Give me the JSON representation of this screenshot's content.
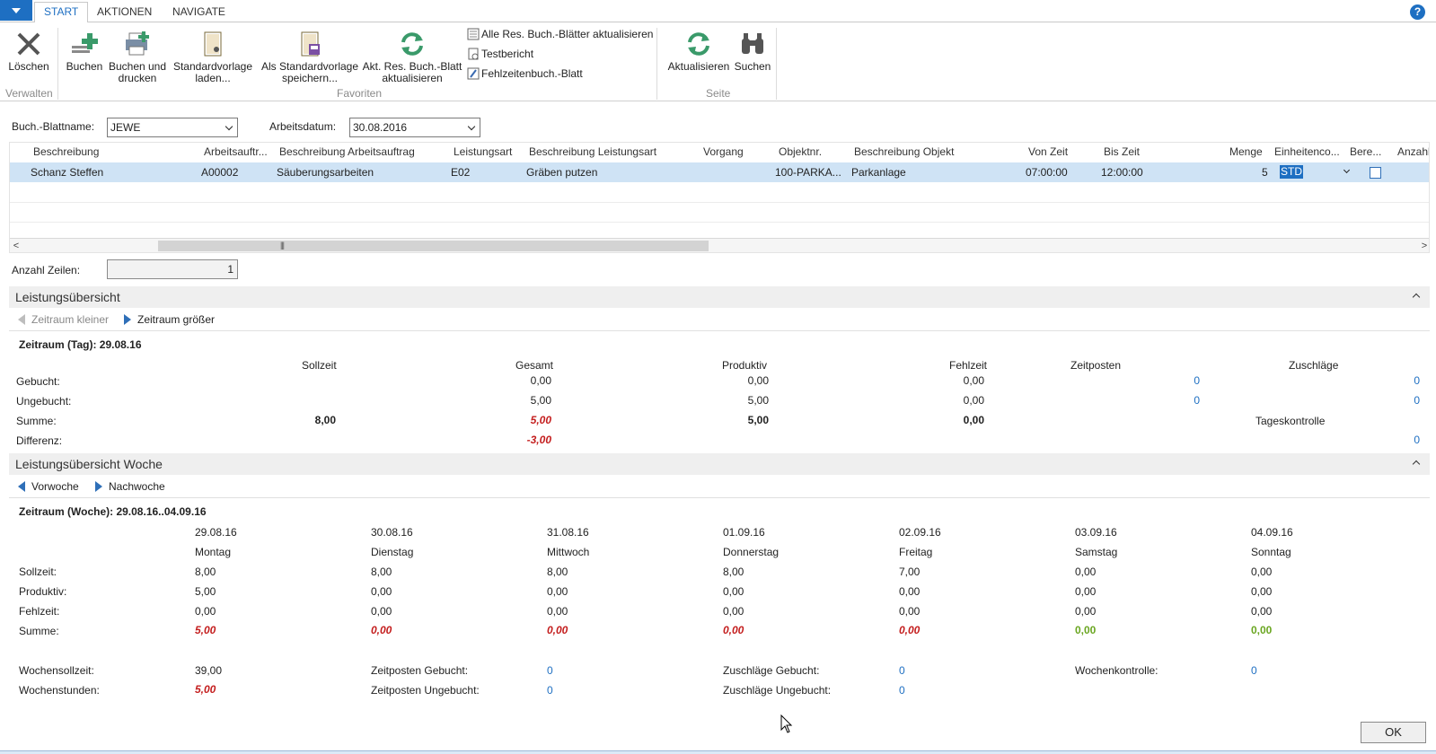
{
  "ribbon": {
    "tabs": [
      "START",
      "AKTIONEN",
      "NAVIGATE"
    ],
    "help": "?",
    "groups": {
      "verwalten": "Verwalten",
      "favoriten": "Favoriten",
      "seite": "Seite"
    },
    "buttons": {
      "loeschen": "Löschen",
      "buchen": "Buchen",
      "buchen_drucken_1": "Buchen und",
      "buchen_drucken_2": "drucken",
      "vorlage_laden_1": "Standardvorlage",
      "vorlage_laden_2": "laden...",
      "vorlage_speichern_1": "Als Standardvorlage",
      "vorlage_speichern_2": "speichern...",
      "akt_blatt_1": "Akt. Res. Buch.-Blatt",
      "akt_blatt_2": "aktualisieren",
      "alle_blaetter": "Alle Res. Buch.-Blätter aktualisieren",
      "testbericht": "Testbericht",
      "fehlzeiten": "Fehlzeitenbuch.-Blatt",
      "aktualisieren": "Aktualisieren",
      "suchen": "Suchen"
    }
  },
  "header": {
    "blattname_label": "Buch.-Blattname:",
    "blattname_value": "JEWE",
    "arbeitsdatum_label": "Arbeitsdatum:",
    "arbeitsdatum_value": "30.08.2016"
  },
  "grid": {
    "columns": [
      "Beschreibung",
      "Arbeitsauftr...",
      "Beschreibung Arbeitsauftrag",
      "Leistungsart",
      "Beschreibung Leistungsart",
      "Vorgang",
      "Objektnr.",
      "Beschreibung Objekt",
      "Von Zeit",
      "Bis Zeit",
      "Menge",
      "Einheitenco...",
      "Bere...",
      "Anzahl"
    ],
    "rows": [
      [
        "Schanz Steffen",
        "A00002",
        "Säuberungsarbeiten",
        "E02",
        "Gräben putzen",
        "",
        "100-PARKA...",
        "Parkanlage",
        "07:00:00",
        "12:00:00",
        "5",
        "STD",
        "",
        ""
      ]
    ]
  },
  "anzahl_zeilen": {
    "label": "Anzahl Zeilen:",
    "value": "1"
  },
  "tag": {
    "title": "Leistungsübersicht",
    "prev": "Zeitraum kleiner",
    "next": "Zeitraum größer",
    "period": "Zeitraum (Tag): 29.08.16",
    "cols": [
      "Sollzeit",
      "Gesamt",
      "Produktiv",
      "Fehlzeit",
      "Zeitposten",
      "Zuschläge"
    ],
    "rows": {
      "gebucht": {
        "label": "Gebucht:",
        "gesamt": "0,00",
        "produktiv": "0,00",
        "fehlzeit": "0,00",
        "zeitposten": "0",
        "zuschlaege": "0"
      },
      "ungebucht": {
        "label": "Ungebucht:",
        "gesamt": "5,00",
        "produktiv": "5,00",
        "fehlzeit": "0,00",
        "zeitposten": "0",
        "zuschlaege": "0"
      },
      "summe": {
        "label": "Summe:",
        "sollzeit": "8,00",
        "gesamt": "5,00",
        "produktiv": "5,00",
        "fehlzeit": "0,00",
        "tageskontrolle": "Tageskontrolle"
      },
      "differenz": {
        "label": "Differenz:",
        "gesamt": "-3,00",
        "kontrolle": "0"
      }
    }
  },
  "woche": {
    "title": "Leistungsübersicht Woche",
    "prev": "Vorwoche",
    "next": "Nachwoche",
    "period": "Zeitraum (Woche): 29.08.16..04.09.16",
    "row_labels": {
      "sollzeit": "Sollzeit:",
      "produktiv": "Produktiv:",
      "fehlzeit": "Fehlzeit:",
      "summe": "Summe:"
    },
    "days": [
      {
        "date": "29.08.16",
        "name": "Montag",
        "sollzeit": "8,00",
        "produktiv": "5,00",
        "fehlzeit": "0,00",
        "summe": "5,00"
      },
      {
        "date": "30.08.16",
        "name": "Dienstag",
        "sollzeit": "8,00",
        "produktiv": "0,00",
        "fehlzeit": "0,00",
        "summe": "0,00"
      },
      {
        "date": "31.08.16",
        "name": "Mittwoch",
        "sollzeit": "8,00",
        "produktiv": "0,00",
        "fehlzeit": "0,00",
        "summe": "0,00"
      },
      {
        "date": "01.09.16",
        "name": "Donnerstag",
        "sollzeit": "8,00",
        "produktiv": "0,00",
        "fehlzeit": "0,00",
        "summe": "0,00"
      },
      {
        "date": "02.09.16",
        "name": "Freitag",
        "sollzeit": "7,00",
        "produktiv": "0,00",
        "fehlzeit": "0,00",
        "summe": "0,00"
      },
      {
        "date": "03.09.16",
        "name": "Samstag",
        "sollzeit": "0,00",
        "produktiv": "0,00",
        "fehlzeit": "0,00",
        "summe": "0,00"
      },
      {
        "date": "04.09.16",
        "name": "Sonntag",
        "sollzeit": "0,00",
        "produktiv": "0,00",
        "fehlzeit": "0,00",
        "summe": "0,00"
      }
    ],
    "summary": {
      "wochensollzeit_label": "Wochensollzeit:",
      "wochensollzeit": "39,00",
      "wochenstunden_label": "Wochenstunden:",
      "wochenstunden": "5,00",
      "zp_gebucht_label": "Zeitposten Gebucht:",
      "zp_gebucht": "0",
      "zp_ungebucht_label": "Zeitposten Ungebucht:",
      "zp_ungebucht": "0",
      "zu_gebucht_label": "Zuschläge Gebucht:",
      "zu_gebucht": "0",
      "zu_ungebucht_label": "Zuschläge Ungebucht:",
      "zu_ungebucht": "0",
      "wochenkontrolle_label": "Wochenkontrolle:",
      "wochenkontrolle": "0"
    }
  },
  "ok": "OK",
  "colors": {
    "accent": "#1e6fc2",
    "negative": "#c41f1f",
    "positive": "#6aa621",
    "selection": "#cfe3f5"
  }
}
